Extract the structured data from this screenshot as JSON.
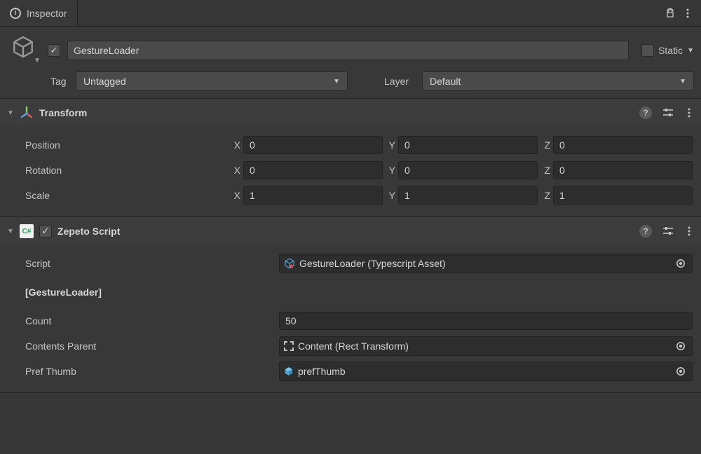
{
  "tab": {
    "label": "Inspector"
  },
  "header": {
    "active": true,
    "name": "GestureLoader",
    "static_label": "Static",
    "tag_label": "Tag",
    "tag_value": "Untagged",
    "layer_label": "Layer",
    "layer_value": "Default"
  },
  "transform": {
    "title": "Transform",
    "rows": {
      "position": {
        "label": "Position",
        "x": "0",
        "y": "0",
        "z": "0"
      },
      "rotation": {
        "label": "Rotation",
        "x": "0",
        "y": "0",
        "z": "0"
      },
      "scale": {
        "label": "Scale",
        "x": "1",
        "y": "1",
        "z": "1"
      }
    },
    "xlabel": "X",
    "ylabel": "Y",
    "zlabel": "Z"
  },
  "script": {
    "title": "Zepeto Script",
    "script_label": "Script",
    "script_value": "GestureLoader (Typescript Asset)",
    "class_header": "[GestureLoader]",
    "count_label": "Count",
    "count_value": "50",
    "contents_parent_label": "Contents Parent",
    "contents_parent_value": "Content (Rect Transform)",
    "pref_thumb_label": "Pref Thumb",
    "pref_thumb_value": "prefThumb"
  }
}
